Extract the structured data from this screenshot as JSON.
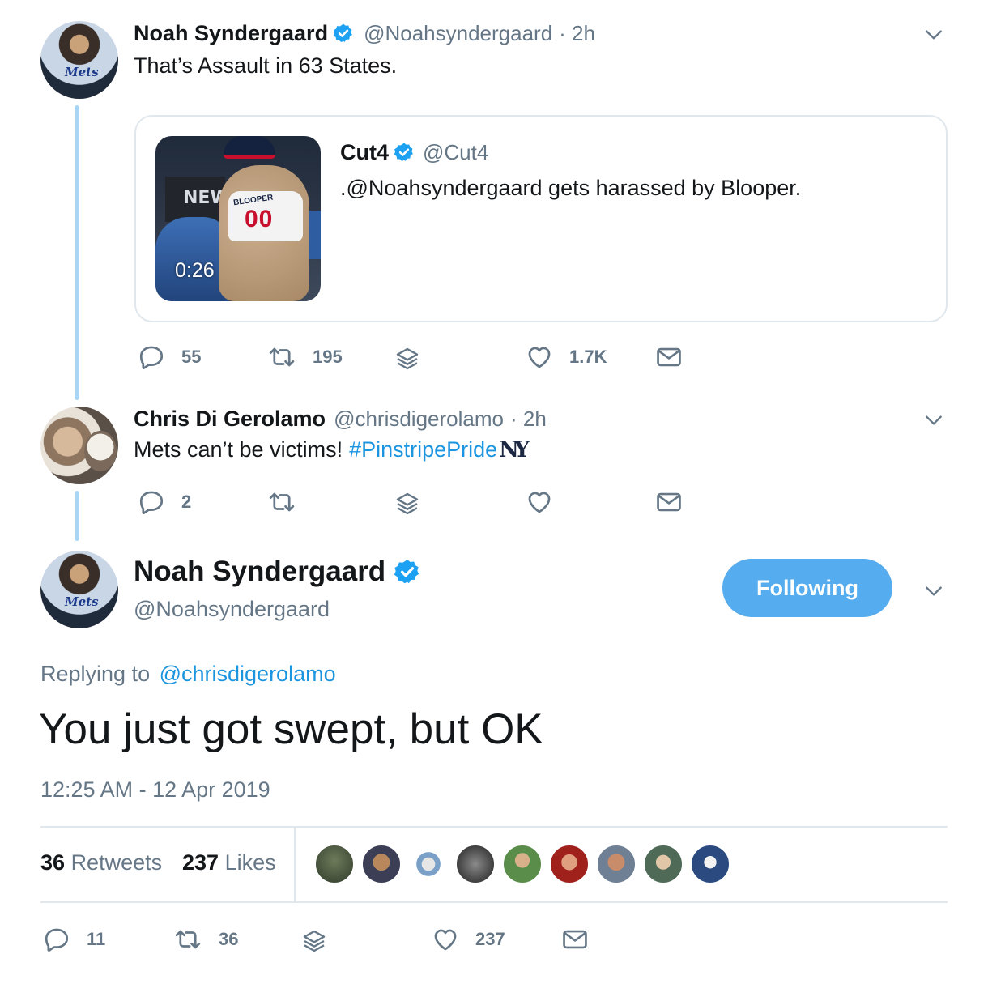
{
  "tweet1": {
    "name": "Noah Syndergaard",
    "handle": "@Noahsyndergaard",
    "time": "· 2h",
    "text": "That’s Assault in 63 States.",
    "actions": {
      "replies": "55",
      "retweets": "195",
      "likes": "1.7K"
    }
  },
  "quoted": {
    "name": "Cut4",
    "handle": "@Cut4",
    "text": ".@Noahsyndergaard gets harassed by Blooper.",
    "video_duration": "0:26",
    "jersey_name": "BLOOPER",
    "jersey_number": "00",
    "bg_sign": "NEW"
  },
  "tweet2": {
    "name": "Chris Di Gerolamo",
    "handle": "@chrisdigerolamo",
    "time": "· 2h",
    "text": "Mets can’t be victims!",
    "hashtag": "#PinstripePride",
    "actions": {
      "replies": "2"
    }
  },
  "main": {
    "name": "Noah Syndergaard",
    "handle": "@Noahsyndergaard",
    "follow_label": "Following",
    "replying_prefix": "Replying to",
    "replying_to": "@chrisdigerolamo",
    "text": "You just got swept, but OK",
    "timestamp": "12:25 AM - 12 Apr 2019",
    "stats": {
      "retweets_count": "36",
      "retweets_label": "Retweets",
      "likes_count": "237",
      "likes_label": "Likes"
    },
    "actions": {
      "replies": "11",
      "retweets": "36",
      "likes": "237"
    }
  },
  "avatar_logo_text": "Mets",
  "colors": {
    "accent": "#1b95e0",
    "follow_button": "#55acee",
    "thread_line": "#a9d6f5",
    "muted": "#657786",
    "border": "#e1e8ed"
  },
  "icons": [
    "reply-icon",
    "retweet-icon",
    "share-layers-icon",
    "heart-icon",
    "envelope-icon",
    "chevron-down-icon",
    "verified-badge-icon",
    "yankees-logo-icon"
  ]
}
